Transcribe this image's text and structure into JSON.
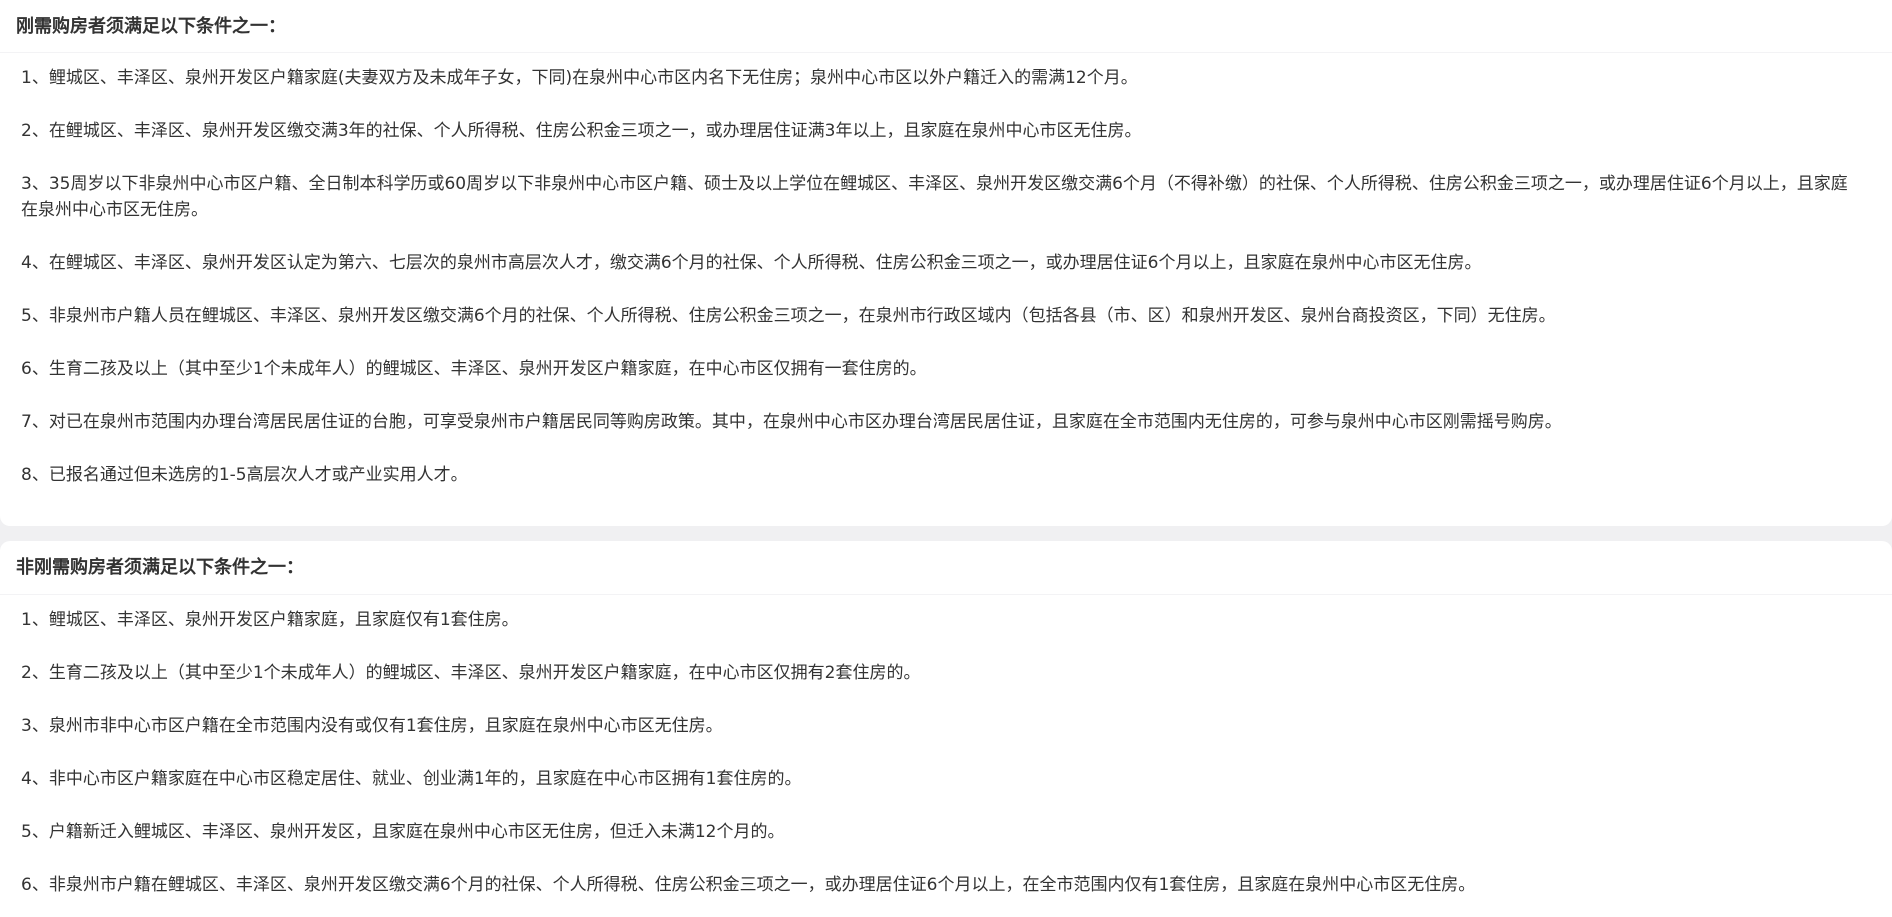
{
  "rigid": {
    "title": "刚需购房者须满足以下条件之一：",
    "items": [
      "1、鲤城区、丰泽区、泉州开发区户籍家庭(夫妻双方及未成年子女，下同)在泉州中心市区内名下无住房；泉州中心市区以外户籍迁入的需满12个月。",
      "2、在鲤城区、丰泽区、泉州开发区缴交满3年的社保、个人所得税、住房公积金三项之一，或办理居住证满3年以上，且家庭在泉州中心市区无住房。",
      "3、35周岁以下非泉州中心市区户籍、全日制本科学历或60周岁以下非泉州中心市区户籍、硕士及以上学位在鲤城区、丰泽区、泉州开发区缴交满6个月（不得补缴）的社保、个人所得税、住房公积金三项之一，或办理居住证6个月以上，且家庭在泉州中心市区无住房。",
      "4、在鲤城区、丰泽区、泉州开发区认定为第六、七层次的泉州市高层次人才，缴交满6个月的社保、个人所得税、住房公积金三项之一，或办理居住证6个月以上，且家庭在泉州中心市区无住房。",
      "5、非泉州市户籍人员在鲤城区、丰泽区、泉州开发区缴交满6个月的社保、个人所得税、住房公积金三项之一，在泉州市行政区域内（包括各县（市、区）和泉州开发区、泉州台商投资区，下同）无住房。",
      "6、生育二孩及以上（其中至少1个未成年人）的鲤城区、丰泽区、泉州开发区户籍家庭，在中心市区仅拥有一套住房的。",
      "7、对已在泉州市范围内办理台湾居民居住证的台胞，可享受泉州市户籍居民同等购房政策。其中，在泉州中心市区办理台湾居民居住证，且家庭在全市范围内无住房的，可参与泉州中心市区刚需摇号购房。",
      "8、已报名通过但未选房的1-5高层次人才或产业实用人才。"
    ]
  },
  "nonrigid": {
    "title": "非刚需购房者须满足以下条件之一：",
    "items": [
      "1、鲤城区、丰泽区、泉州开发区户籍家庭，且家庭仅有1套住房。",
      "2、生育二孩及以上（其中至少1个未成年人）的鲤城区、丰泽区、泉州开发区户籍家庭，在中心市区仅拥有2套住房的。",
      "3、泉州市非中心市区户籍在全市范围内没有或仅有1套住房，且家庭在泉州中心市区无住房。",
      "4、非中心市区户籍家庭在中心市区稳定居住、就业、创业满1年的，且家庭在中心市区拥有1套住房的。",
      "5、户籍新迁入鲤城区、丰泽区、泉州开发区，且家庭在泉州中心市区无住房，但迁入未满12个月的。",
      "6、非泉州市户籍在鲤城区、丰泽区、泉州开发区缴交满6个月的社保、个人所得税、住房公积金三项之一，或办理居住证6个月以上，在全市范围内仅有1套住房，且家庭在泉州中心市区无住房。"
    ]
  }
}
